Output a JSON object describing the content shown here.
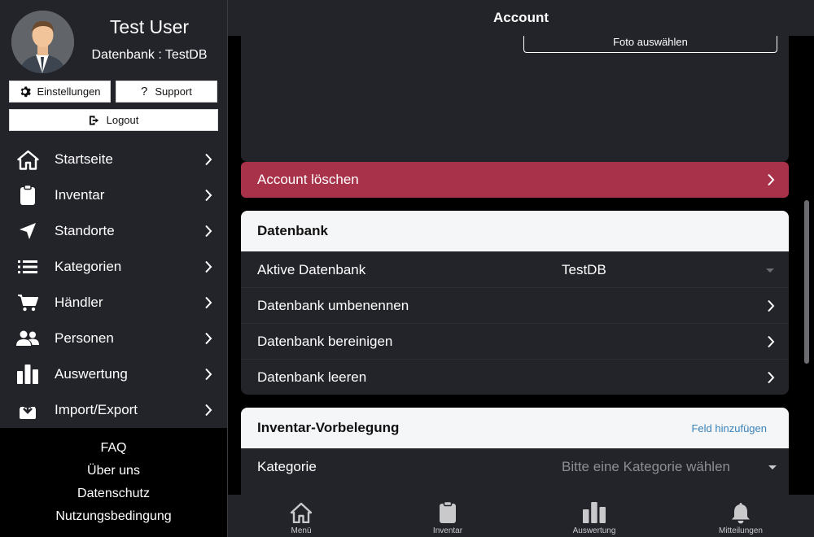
{
  "sidebar": {
    "user_name": "Test User",
    "database_line": "Datenbank : TestDB",
    "buttons": {
      "settings": "Einstellungen",
      "support": "Support",
      "logout": "Logout"
    },
    "nav": [
      {
        "label": "Startseite",
        "icon": "home-icon"
      },
      {
        "label": "Inventar",
        "icon": "clipboard-icon"
      },
      {
        "label": "Standorte",
        "icon": "location-arrow-icon"
      },
      {
        "label": "Kategorien",
        "icon": "list-icon"
      },
      {
        "label": "Händler",
        "icon": "cart-icon"
      },
      {
        "label": "Personen",
        "icon": "users-icon"
      },
      {
        "label": "Auswertung",
        "icon": "chart-icon"
      },
      {
        "label": "Import/Export",
        "icon": "download-icon"
      }
    ],
    "footer_links": [
      "FAQ",
      "Über uns",
      "Datenschutz",
      "Nutzungsbedingung"
    ]
  },
  "header": {
    "title": "Account"
  },
  "account": {
    "photo_button": "Foto auswählen",
    "delete_label": "Account löschen"
  },
  "database_section": {
    "title": "Datenbank",
    "active_label": "Aktive Datenbank",
    "active_value": "TestDB",
    "rename_label": "Datenbank umbenennen",
    "cleanup_label": "Datenbank bereinigen",
    "empty_label": "Datenbank leeren"
  },
  "inventory_section": {
    "title": "Inventar-Vorbelegung",
    "add_field": "Feld hinzufügen",
    "category_label": "Kategorie",
    "category_placeholder": "Bitte eine Kategorie wählen"
  },
  "tabbar": {
    "tabs": [
      {
        "label": "Menü",
        "icon": "home-icon"
      },
      {
        "label": "Inventar",
        "icon": "clipboard-icon"
      },
      {
        "label": "Auswertung",
        "icon": "chart-icon"
      },
      {
        "label": "Mitteilungen",
        "icon": "bell-icon"
      }
    ]
  },
  "colors": {
    "sidebar_bg": "#23242a",
    "danger": "#a8324a",
    "link_blue": "#3a82b8",
    "section_header_bg": "#f5f6f8"
  }
}
